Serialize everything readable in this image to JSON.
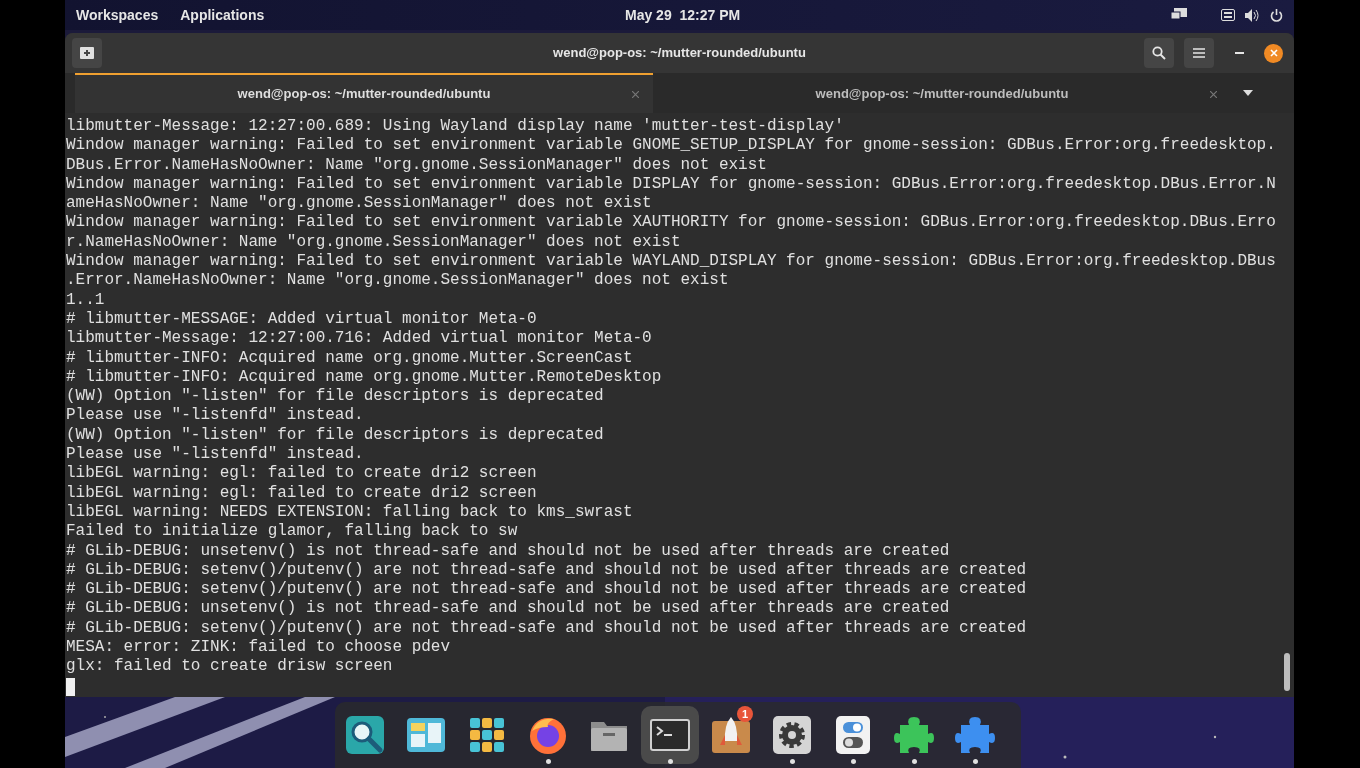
{
  "top_bar": {
    "workspaces": "Workspaces",
    "applications": "Applications",
    "clock": "May 29  12:27 PM"
  },
  "window": {
    "title": "wend@pop-os: ~/mutter-rounded/ubuntu"
  },
  "tabs": [
    {
      "label": "wend@pop-os: ~/mutter-rounded/ubuntu",
      "selected": true
    },
    {
      "label": "wend@pop-os: ~/mutter-rounded/ubuntu",
      "selected": false
    }
  ],
  "terminal_lines": [
    "libmutter-Message: 12:27:00.689: Using Wayland display name 'mutter-test-display'",
    "Window manager warning: Failed to set environment variable GNOME_SETUP_DISPLAY for gnome-session: GDBus.Error:org.freedesktop.",
    "DBus.Error.NameHasNoOwner: Name \"org.gnome.SessionManager\" does not exist",
    "Window manager warning: Failed to set environment variable DISPLAY for gnome-session: GDBus.Error:org.freedesktop.DBus.Error.N",
    "ameHasNoOwner: Name \"org.gnome.SessionManager\" does not exist",
    "Window manager warning: Failed to set environment variable XAUTHORITY for gnome-session: GDBus.Error:org.freedesktop.DBus.Erro",
    "r.NameHasNoOwner: Name \"org.gnome.SessionManager\" does not exist",
    "Window manager warning: Failed to set environment variable WAYLAND_DISPLAY for gnome-session: GDBus.Error:org.freedesktop.DBus",
    ".Error.NameHasNoOwner: Name \"org.gnome.SessionManager\" does not exist",
    "1..1",
    "# libmutter-MESSAGE: Added virtual monitor Meta-0",
    "libmutter-Message: 12:27:00.716: Added virtual monitor Meta-0",
    "# libmutter-INFO: Acquired name org.gnome.Mutter.ScreenCast",
    "# libmutter-INFO: Acquired name org.gnome.Mutter.RemoteDesktop",
    "(WW) Option \"-listen\" for file descriptors is deprecated",
    "Please use \"-listenfd\" instead.",
    "(WW) Option \"-listen\" for file descriptors is deprecated",
    "Please use \"-listenfd\" instead.",
    "libEGL warning: egl: failed to create dri2 screen",
    "libEGL warning: egl: failed to create dri2 screen",
    "libEGL warning: NEEDS EXTENSION: falling back to kms_swrast",
    "Failed to initialize glamor, falling back to sw",
    "# GLib-DEBUG: unsetenv() is not thread-safe and should not be used after threads are created",
    "# GLib-DEBUG: setenv()/putenv() are not thread-safe and should not be used after threads are created",
    "# GLib-DEBUG: setenv()/putenv() are not thread-safe and should not be used after threads are created",
    "# GLib-DEBUG: unsetenv() is not thread-safe and should not be used after threads are created",
    "# GLib-DEBUG: setenv()/putenv() are not thread-safe and should not be used after threads are created",
    "MESA: error: ZINK: failed to choose pdev",
    "glx: failed to create drisw screen"
  ],
  "dock": [
    {
      "kind": "search",
      "running": false,
      "focused": false
    },
    {
      "kind": "layout",
      "running": false,
      "focused": false
    },
    {
      "kind": "grid",
      "running": false,
      "focused": false
    },
    {
      "kind": "browser",
      "running": true,
      "focused": false
    },
    {
      "kind": "folder",
      "running": false,
      "focused": false
    },
    {
      "kind": "terminal",
      "running": true,
      "focused": true
    },
    {
      "kind": "rocket",
      "running": false,
      "focused": false,
      "badge": "1"
    },
    {
      "kind": "gear",
      "running": true,
      "focused": false
    },
    {
      "kind": "toggle",
      "running": true,
      "focused": false
    },
    {
      "kind": "puzzle-green",
      "running": true,
      "focused": false
    },
    {
      "kind": "puzzle-blue",
      "running": true,
      "focused": false
    }
  ]
}
